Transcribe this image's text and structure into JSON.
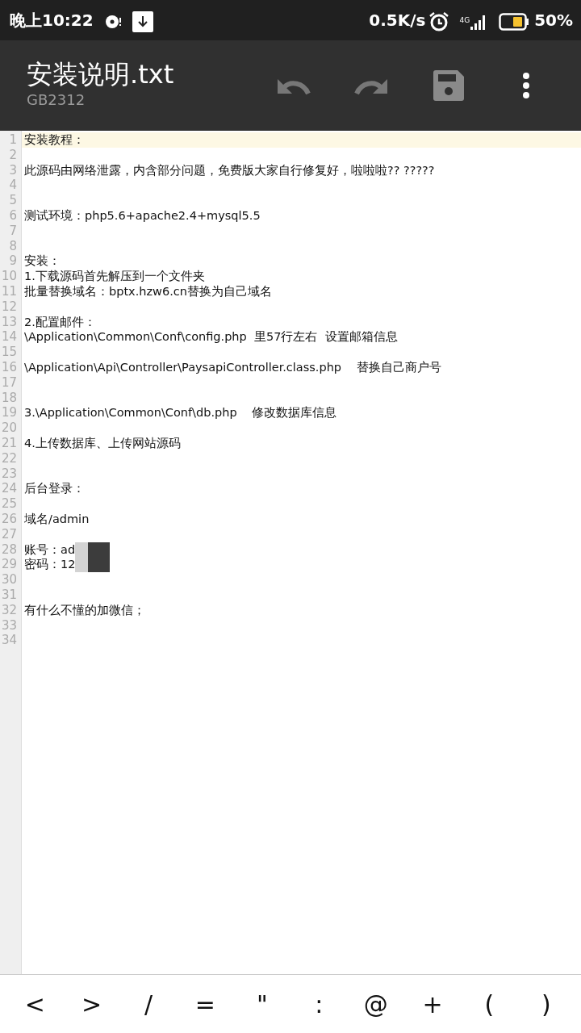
{
  "status_bar": {
    "time": "晚上10:22",
    "speed": "0.5K/s",
    "network": "4G",
    "battery": "50%"
  },
  "toolbar": {
    "title": "安装说明.txt",
    "encoding": "GB2312"
  },
  "editor": {
    "lines": [
      {
        "number": "1",
        "text": "安装教程：",
        "current": true
      },
      {
        "number": "2",
        "current": false
      },
      {
        "number": "3",
        "text": "此源码由网络泄露，内含部分问题，免费版大家自行修复好，啦啦啦?? ?????",
        "current": false
      },
      {
        "number": "4",
        "current": false
      },
      {
        "number": "5",
        "current": false
      },
      {
        "number": "6",
        "text": "测试环境：php5.6+apache2.4+mysql5.5",
        "current": false
      },
      {
        "number": "7",
        "current": false
      },
      {
        "number": "8",
        "current": false
      },
      {
        "number": "9",
        "text": "安装：",
        "current": false
      },
      {
        "number": "10",
        "text": "1.下载源码首先解压到一个文件夹",
        "current": false
      },
      {
        "number": "11",
        "text": "批量替换域名：bptx.hzw6.cn替换为自己域名",
        "current": false
      },
      {
        "number": "12",
        "current": false
      },
      {
        "number": "13",
        "text": "2.配置邮件：",
        "current": false
      },
      {
        "number": "14",
        "text": "\\Application\\Common\\Conf\\config.php  里57行左右  设置邮箱信息",
        "current": false
      },
      {
        "number": "15",
        "current": false
      },
      {
        "number": "16",
        "text": "\\Application\\Api\\Controller\\PaysapiController.class.php    替换自己商户号",
        "current": false
      },
      {
        "number": "17",
        "current": false
      },
      {
        "number": "18",
        "current": false
      },
      {
        "number": "19",
        "text": "3.\\Application\\Common\\Conf\\db.php    修改数据库信息",
        "current": false
      },
      {
        "number": "20",
        "current": false
      },
      {
        "number": "21",
        "text": "4.上传数据库、上传网站源码",
        "current": false
      },
      {
        "number": "22",
        "current": false
      },
      {
        "number": "23",
        "current": false
      },
      {
        "number": "24",
        "text": "后台登录：",
        "current": false
      },
      {
        "number": "25",
        "current": false
      },
      {
        "number": "26",
        "text": "域名/admin",
        "current": false
      },
      {
        "number": "27",
        "current": false
      },
      {
        "number": "28",
        "text": "账号：ad",
        "current": false,
        "redacted": true
      },
      {
        "number": "29",
        "text": "密码：12",
        "current": false,
        "redacted": true
      },
      {
        "number": "30",
        "current": false
      },
      {
        "number": "31",
        "current": false
      },
      {
        "number": "32",
        "text": "有什么不懂的加微信；",
        "current": false
      },
      {
        "number": "33",
        "current": false
      },
      {
        "number": "34",
        "current": false
      }
    ]
  },
  "symbol_keys": [
    "<",
    ">",
    "/",
    "=",
    "\"",
    ":",
    "@",
    "+",
    "(",
    ")"
  ]
}
